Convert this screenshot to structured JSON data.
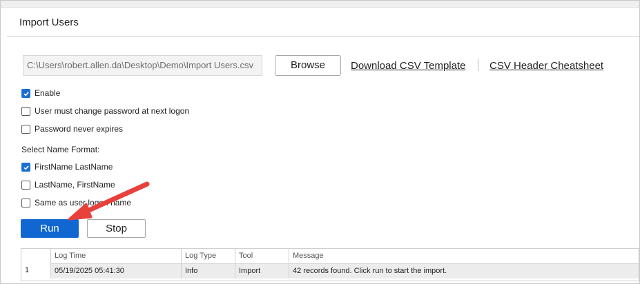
{
  "panel": {
    "title": "Import Users"
  },
  "file": {
    "path_value": "C:\\Users\\robert.allen.da\\Desktop\\Demo\\Import Users.csv",
    "browse_label": "Browse",
    "download_template_label": "Download CSV Template",
    "cheatsheet_label": "CSV Header Cheatsheet"
  },
  "options": [
    {
      "label": "Enable",
      "checked": true
    },
    {
      "label": "User must change password at next logon",
      "checked": false
    },
    {
      "label": "Password never expires",
      "checked": false
    }
  ],
  "name_format": {
    "label": "Select Name Format:",
    "options": [
      {
        "label": "FirstName LastName",
        "checked": true
      },
      {
        "label": "LastName, FirstName",
        "checked": false
      },
      {
        "label": "Same as user logon name",
        "checked": false
      }
    ]
  },
  "actions": {
    "run_label": "Run",
    "stop_label": "Stop"
  },
  "log": {
    "columns": [
      "",
      "Log Time",
      "Log Type",
      "Tool",
      "Message"
    ],
    "rows": [
      [
        "1",
        "05/19/2025 05:41:30",
        "Info",
        "Import",
        "42 records found. Click run to start the import."
      ]
    ]
  },
  "colors": {
    "accent": "#1167d1",
    "annotation_arrow": "#e8413c"
  }
}
